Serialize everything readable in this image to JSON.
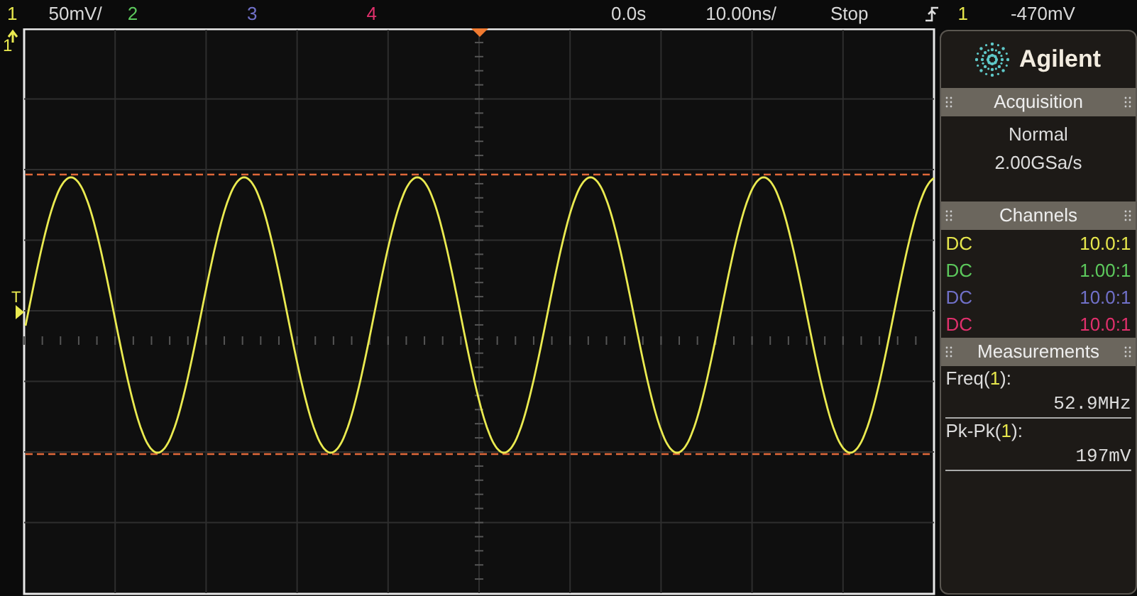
{
  "status_bar": {
    "channels": [
      {
        "label": "1",
        "color": "#e6e64c"
      },
      {
        "label": "2",
        "color": "#5cc85c"
      },
      {
        "label": "3",
        "color": "#7070c8"
      },
      {
        "label": "4",
        "color": "#e0306c"
      }
    ],
    "scale": "50mV/",
    "delay": "0.0s",
    "timebase": "10.00ns/",
    "run_state": "Stop",
    "trigger_channel": "1",
    "trigger_level": "-470mV"
  },
  "display": {
    "channel_marker": "1",
    "trigger_marker": "T"
  },
  "sidebar": {
    "brand": "Agilent",
    "acquisition": {
      "title": "Acquisition",
      "mode": "Normal",
      "sample_rate": "2.00GSa/s"
    },
    "channels": {
      "title": "Channels",
      "rows": [
        {
          "coupling": "DC",
          "probe": "10.0:1",
          "color": "#e6e64c"
        },
        {
          "coupling": "DC",
          "probe": "1.00:1",
          "color": "#5cc85c"
        },
        {
          "coupling": "DC",
          "probe": "10.0:1",
          "color": "#7070c8"
        },
        {
          "coupling": "DC",
          "probe": "10.0:1",
          "color": "#e0306c"
        }
      ]
    },
    "measurements": {
      "title": "Measurements",
      "items": [
        {
          "name": "Freq(",
          "source": "1",
          "suffix": "):",
          "value": "52.9MHz"
        },
        {
          "name": "Pk-Pk(",
          "source": "1",
          "suffix": "):",
          "value": "197mV"
        }
      ]
    }
  }
}
